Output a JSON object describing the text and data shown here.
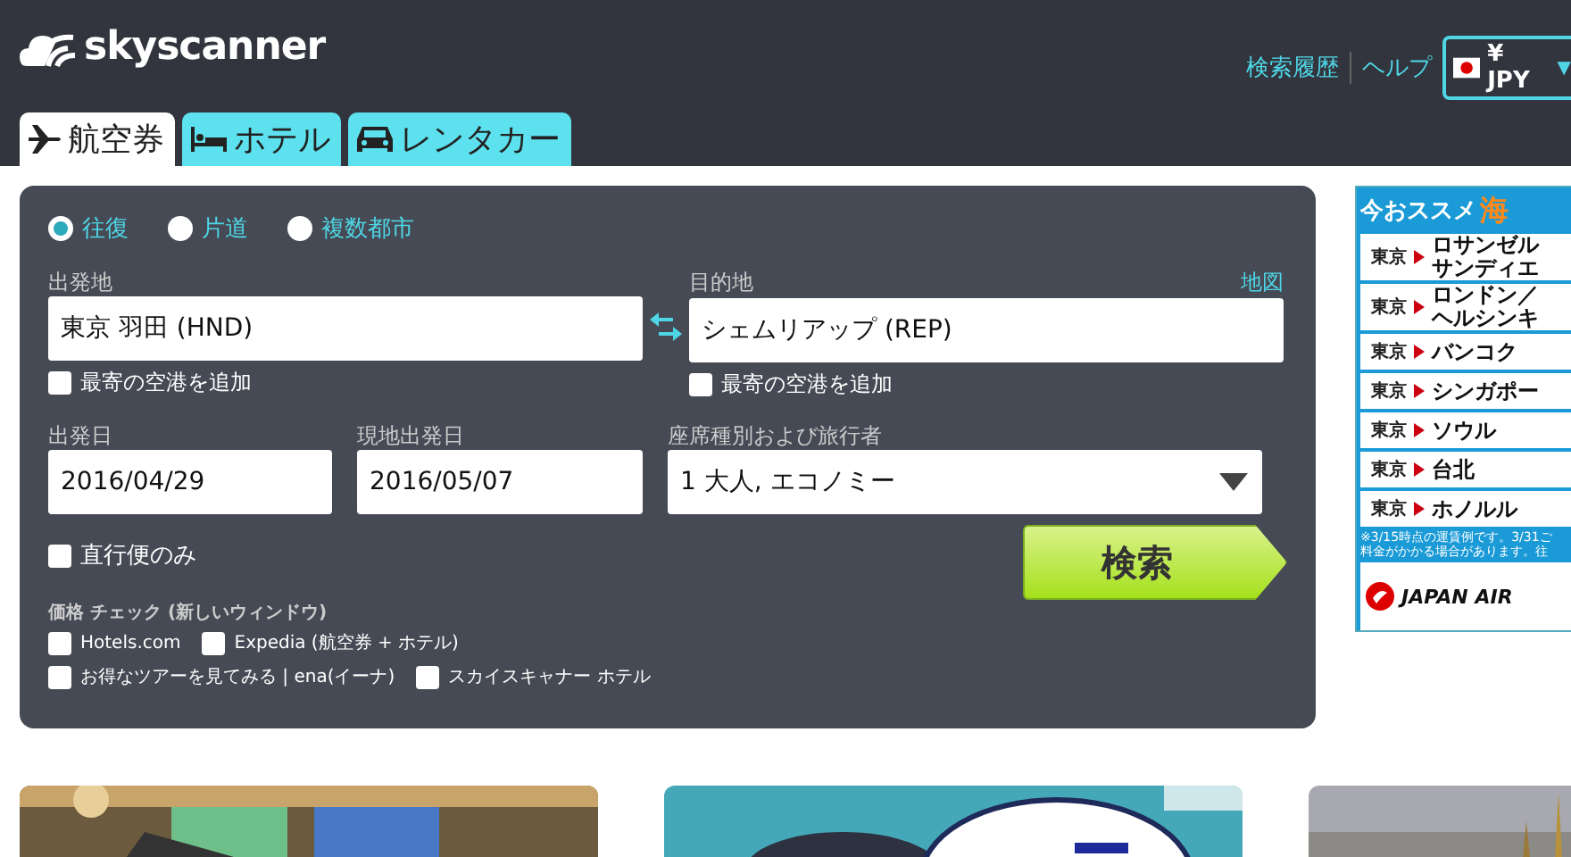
{
  "header": {
    "logo": "skyscanner",
    "links": [
      "検索履歴",
      "ヘルプ"
    ],
    "currency": "¥ JPY",
    "currency_caret": "▼"
  },
  "tabs": [
    {
      "label": "航空券",
      "kind": "plane",
      "selected": true
    },
    {
      "label": "ホテル",
      "kind": "bed",
      "selected": false
    },
    {
      "label": "レンタカー",
      "kind": "car",
      "selected": false
    }
  ],
  "trip_types": [
    {
      "label": "往復",
      "selected": true
    },
    {
      "label": "片道",
      "selected": false
    },
    {
      "label": "複数都市",
      "selected": false
    }
  ],
  "origin": {
    "label": "出発地",
    "value": "東京 羽田 (HND)",
    "nearby": {
      "label": "最寄の空港を追加",
      "checked": false
    }
  },
  "destination": {
    "label": "目的地",
    "map_link": "地図",
    "value": "シェムリアップ (REP)",
    "nearby": {
      "label": "最寄の空港を追加",
      "checked": false
    }
  },
  "depart": {
    "label": "出発日",
    "value": "2016/04/29"
  },
  "return": {
    "label": "現地出発日",
    "value": "2016/05/07"
  },
  "cabin": {
    "label": "座席種別および旅行者",
    "value": "1 大人, エコノミー"
  },
  "direct_only": {
    "label": "直行便のみ",
    "checked": false
  },
  "search_button": "検索",
  "price_check": {
    "title": "価格 チェック (新しいウィンドウ)",
    "options": [
      {
        "label": "Hotels.com",
        "checked": false
      },
      {
        "label": "Expedia (航空券 + ホテル)",
        "checked": false
      },
      {
        "label": "お得なツアーを見てみる | ena(イーナ)",
        "checked": false
      },
      {
        "label": "スカイスキャナー ホテル",
        "checked": false
      }
    ]
  },
  "ad": {
    "title": "今おススメ",
    "title_accent": "海",
    "routes": [
      {
        "from": "東京",
        "to": [
          "ロサンゼル",
          "サンディエ"
        ]
      },
      {
        "from": "東京",
        "to": [
          "ロンドン／",
          "ヘルシンキ"
        ]
      },
      {
        "from": "東京",
        "to": [
          "バンコク"
        ]
      },
      {
        "from": "東京",
        "to": [
          "シンガポー"
        ]
      },
      {
        "from": "東京",
        "to": [
          "ソウル"
        ]
      },
      {
        "from": "東京",
        "to": [
          "台北"
        ]
      },
      {
        "from": "東京",
        "to": [
          "ホノルル"
        ]
      }
    ],
    "note": [
      "※3/15時点の運賃例です。3/31ご",
      "料金がかかる場合があります。往"
    ],
    "airline": "JAPAN AIR"
  }
}
